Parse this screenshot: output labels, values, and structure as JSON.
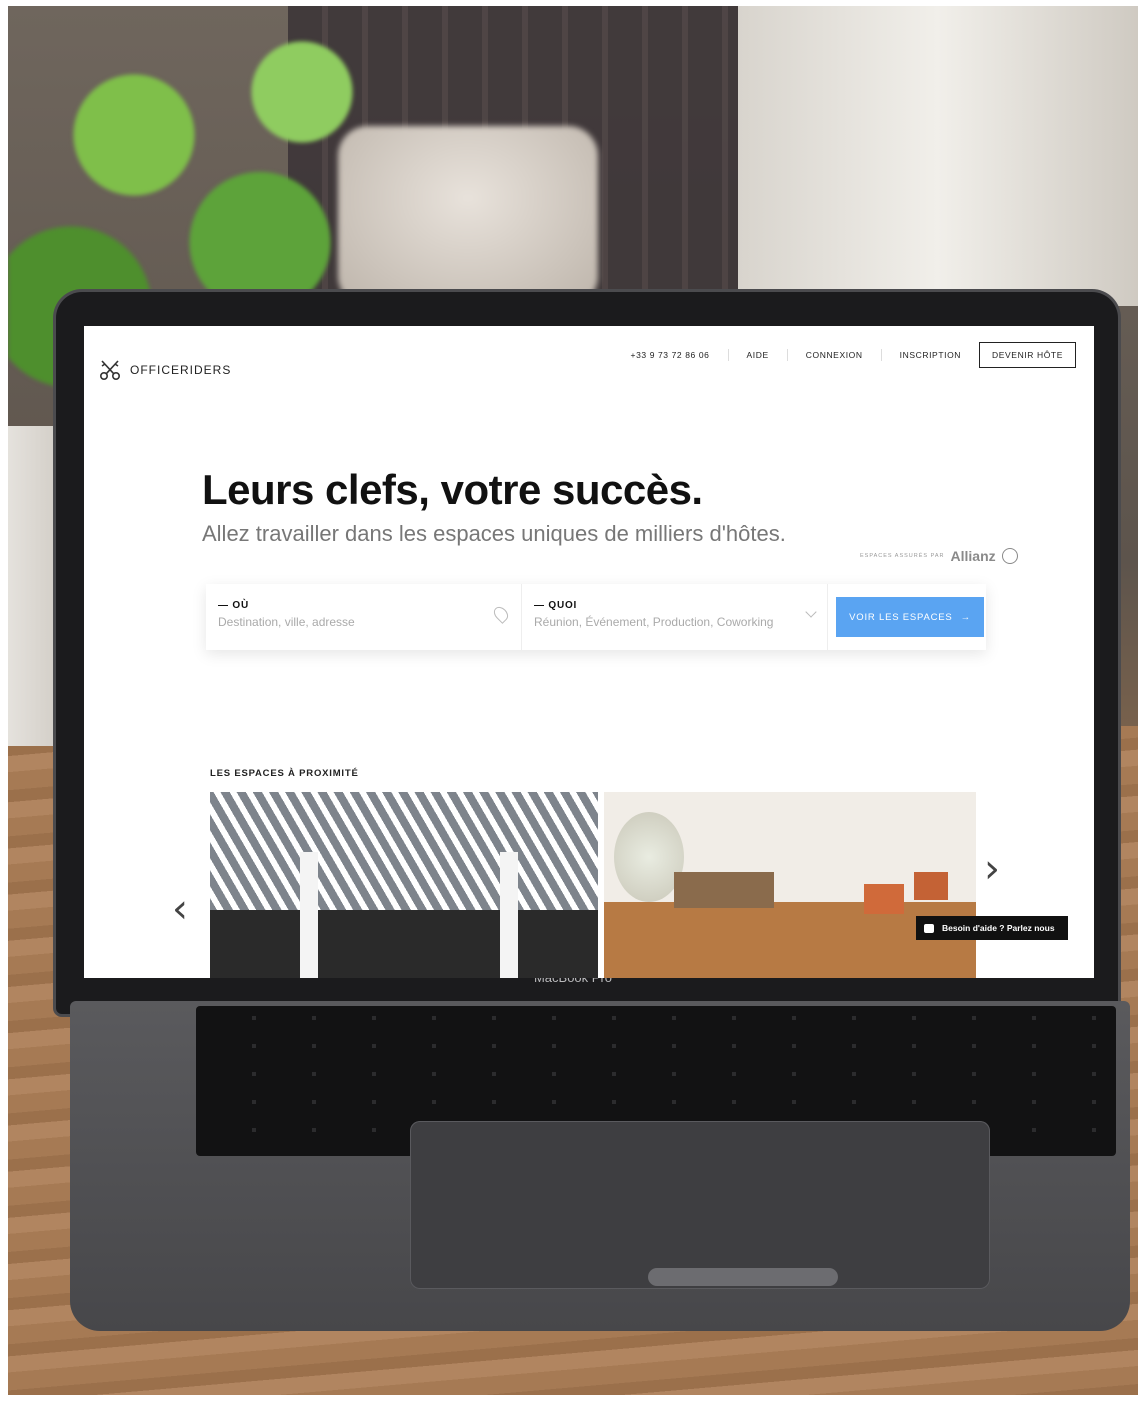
{
  "device": {
    "label": "MacBook Pro"
  },
  "brand": {
    "name": "OFFICERIDERS",
    "icon": "keys-crossed-icon"
  },
  "nav": {
    "phone": "+33 9 73 72 86 06",
    "help": "AIDE",
    "login": "CONNEXION",
    "signup": "INSCRIPTION",
    "become_host": "DEVENIR HÔTE"
  },
  "hero": {
    "title": "Leurs clefs, votre succès.",
    "subtitle": "Allez travailler dans les espaces uniques de milliers d'hôtes."
  },
  "insurance": {
    "small": "ESPACES ASSURÉS PAR",
    "brand": "Allianz"
  },
  "search": {
    "where_label": "— OÙ",
    "where_placeholder": "Destination, ville, adresse",
    "what_label": "— QUOI",
    "what_placeholder": "Réunion, Événement, Production, Coworking",
    "button": "VOIR LES ESPACES",
    "button_arrow": "→"
  },
  "nearby": {
    "title": "LES ESPACES À PROXIMITÉ"
  },
  "carousel": {
    "prev": "‹",
    "next": "›"
  },
  "chat": {
    "label": "Besoin d'aide ? Parlez nous"
  },
  "colors": {
    "accent": "#5aa4f2",
    "text": "#111111"
  }
}
